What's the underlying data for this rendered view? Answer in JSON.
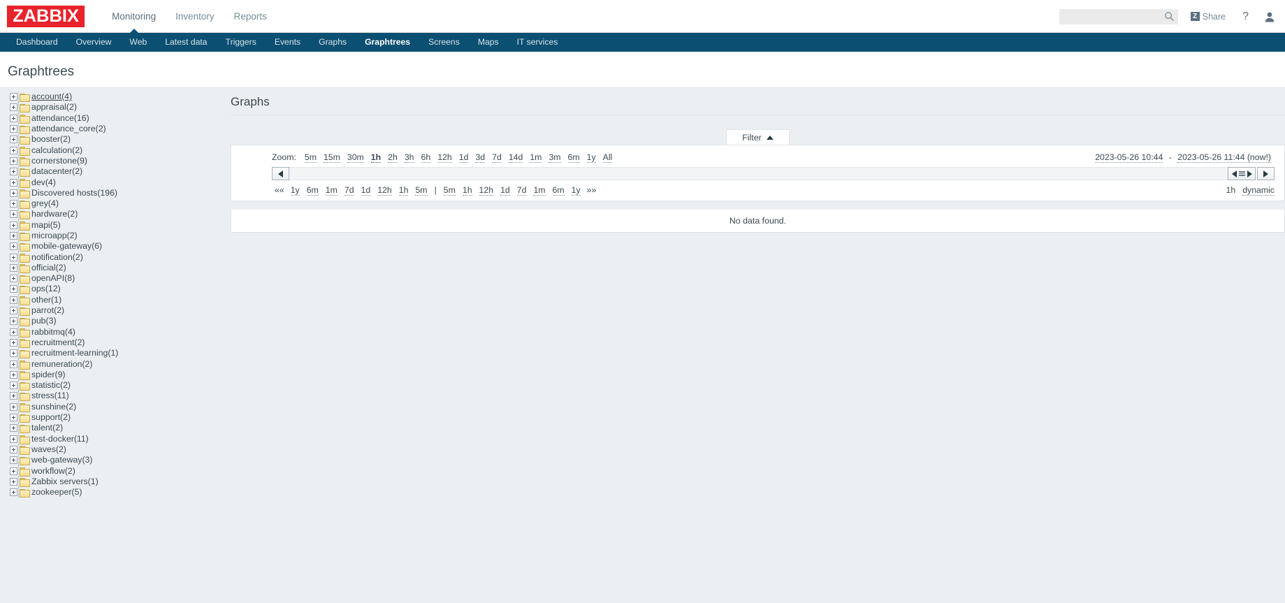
{
  "header": {
    "logo": "ZABBIX",
    "nav": [
      {
        "label": "Monitoring",
        "active": true
      },
      {
        "label": "Inventory",
        "active": false
      },
      {
        "label": "Reports",
        "active": false
      }
    ],
    "search": {
      "value": "",
      "placeholder": ""
    },
    "share_label": "Share",
    "share_icon_letter": "Z",
    "help_label": "?",
    "icons": {
      "search": "search-icon",
      "user": "user-icon",
      "share": "share-icon"
    }
  },
  "subnav": [
    {
      "label": "Dashboard",
      "active": false
    },
    {
      "label": "Overview",
      "active": false
    },
    {
      "label": "Web",
      "active": false
    },
    {
      "label": "Latest data",
      "active": false
    },
    {
      "label": "Triggers",
      "active": false
    },
    {
      "label": "Events",
      "active": false
    },
    {
      "label": "Graphs",
      "active": false
    },
    {
      "label": "Graphtrees",
      "active": true
    },
    {
      "label": "Screens",
      "active": false
    },
    {
      "label": "Maps",
      "active": false
    },
    {
      "label": "IT services",
      "active": false
    }
  ],
  "page": {
    "title": "Graphtrees",
    "section_title": "Graphs"
  },
  "tree": [
    {
      "label": "account(4)"
    },
    {
      "label": "appraisal(2)"
    },
    {
      "label": "attendance(16)"
    },
    {
      "label": "attendance_core(2)"
    },
    {
      "label": "booster(2)"
    },
    {
      "label": "calculation(2)"
    },
    {
      "label": "cornerstone(9)"
    },
    {
      "label": "datacenter(2)"
    },
    {
      "label": "dev(4)"
    },
    {
      "label": "Discovered hosts(196)"
    },
    {
      "label": "grey(4)"
    },
    {
      "label": "hardware(2)"
    },
    {
      "label": "mapi(5)"
    },
    {
      "label": "microapp(2)"
    },
    {
      "label": "mobile-gateway(6)"
    },
    {
      "label": "notification(2)"
    },
    {
      "label": "official(2)"
    },
    {
      "label": "openAPI(8)"
    },
    {
      "label": "ops(12)"
    },
    {
      "label": "other(1)"
    },
    {
      "label": "parrot(2)"
    },
    {
      "label": "pub(3)"
    },
    {
      "label": "rabbitmq(4)"
    },
    {
      "label": "recruitment(2)"
    },
    {
      "label": "recruitment-learning(1)"
    },
    {
      "label": "remuneration(2)"
    },
    {
      "label": "spider(9)"
    },
    {
      "label": "statistic(2)"
    },
    {
      "label": "stress(11)"
    },
    {
      "label": "sunshine(2)"
    },
    {
      "label": "support(2)"
    },
    {
      "label": "talent(2)"
    },
    {
      "label": "test-docker(11)"
    },
    {
      "label": "waves(2)"
    },
    {
      "label": "web-gateway(3)"
    },
    {
      "label": "workflow(2)"
    },
    {
      "label": "Zabbix servers(1)"
    },
    {
      "label": "zookeeper(5)"
    }
  ],
  "filter": {
    "tab_label": "Filter",
    "zoom_label": "Zoom:",
    "zoom_options": [
      {
        "label": "5m",
        "active": false
      },
      {
        "label": "15m",
        "active": false
      },
      {
        "label": "30m",
        "active": false
      },
      {
        "label": "1h",
        "active": true
      },
      {
        "label": "2h",
        "active": false
      },
      {
        "label": "3h",
        "active": false
      },
      {
        "label": "6h",
        "active": false
      },
      {
        "label": "12h",
        "active": false
      },
      {
        "label": "1d",
        "active": false
      },
      {
        "label": "3d",
        "active": false
      },
      {
        "label": "7d",
        "active": false
      },
      {
        "label": "14d",
        "active": false
      },
      {
        "label": "1m",
        "active": false
      },
      {
        "label": "3m",
        "active": false
      },
      {
        "label": "6m",
        "active": false
      },
      {
        "label": "1y",
        "active": false
      },
      {
        "label": "All",
        "active": false
      }
    ],
    "date_from": "2023-05-26 10:44",
    "date_sep": " - ",
    "date_to": "2023-05-26 11:44 (now!)",
    "nav_prev_arrows": "««",
    "nav_next_arrows": "»»",
    "shift_back": [
      "1y",
      "6m",
      "1m",
      "7d",
      "1d",
      "12h",
      "1h",
      "5m"
    ],
    "shift_separator": "|",
    "shift_forward": [
      "5m",
      "1h",
      "12h",
      "1d",
      "7d",
      "1m",
      "6m",
      "1y"
    ],
    "period_value": "1h",
    "mode_label": "dynamic"
  },
  "content": {
    "no_data": "No data found."
  }
}
